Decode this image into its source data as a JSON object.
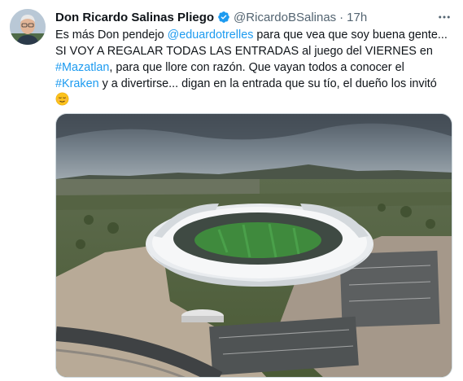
{
  "author": {
    "display_name": "Don Ricardo Salinas Pliego",
    "handle": "@RicardoBSalinas",
    "separator": "·",
    "time": "17h",
    "verified_icon": "verified-badge-icon",
    "verified_color": "#1d9bf0"
  },
  "tweet": {
    "line1_text": "Es más Don pendejo ",
    "line1_mention": "@eduardotrelles",
    "line1_rest": " para que vea que soy buena gente...",
    "line2_text": "SI VOY A REGALAR TODAS LAS ENTRADAS al juego del VIERNES en",
    "line3_hashtag": "#Mazatlan",
    "line3_rest": ", para que llore con razón. Que vayan todos a conocer el",
    "line4_hashtag": "#Kraken",
    "line4_rest": " y a divertirse... digan en la entrada que su tío, el dueño los invitó",
    "emoji": "relieved-face-emoji"
  },
  "colors": {
    "link": "#1d9bf0",
    "text": "#0f1419",
    "secondary": "#536471"
  },
  "more_icon": "more-options-icon"
}
